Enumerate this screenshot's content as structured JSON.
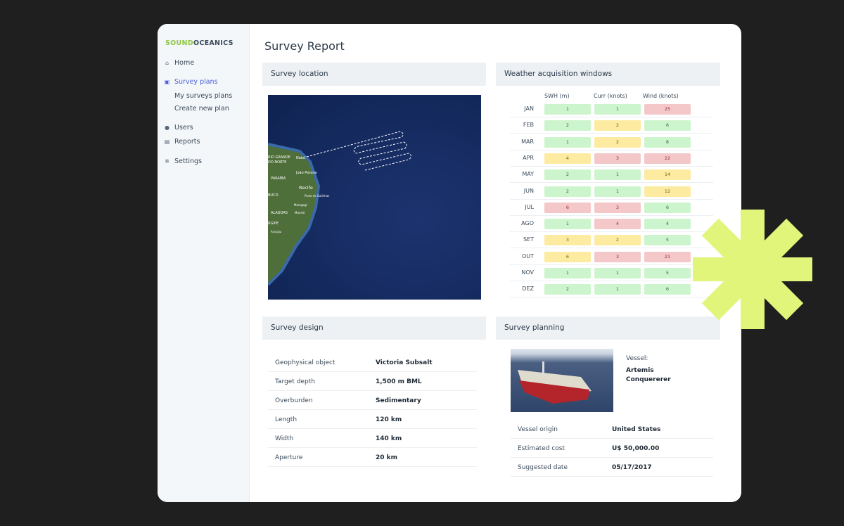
{
  "brand": {
    "part1": "SOUND",
    "part2": "OCEANICS"
  },
  "sidebar": {
    "items": [
      {
        "label": "Home",
        "icon": "home-icon"
      },
      {
        "label": "Survey plans",
        "icon": "survey-plans-icon",
        "active": true,
        "children": [
          "My surveys plans",
          "Create new plan"
        ]
      },
      {
        "label": "Users",
        "icon": "user-icon"
      },
      {
        "label": "Reports",
        "icon": "reports-icon"
      },
      {
        "label": "Settings",
        "icon": "gear-icon"
      }
    ]
  },
  "page_title": "Survey Report",
  "location": {
    "title": "Survey location",
    "map_labels": [
      "Natal",
      "RIO GRANDE",
      "DO NORTE",
      "João Pessoa",
      "PARAÍBA",
      "Recife",
      "BUCO",
      "Porto de Galinhas",
      "Maragogi",
      "ALAGOAS",
      "Maceió",
      "RGIPE",
      "Aracaju"
    ]
  },
  "weather": {
    "title": "Weather acquisition windows",
    "columns": [
      "SWH (m)",
      "Curr (knots)",
      "Wind (knots)"
    ],
    "status_colors": {
      "good": "#cdf5cd",
      "moderate": "#fcebA0",
      "bad": "#f4c7c9"
    },
    "rows": [
      {
        "month": "JAN",
        "values": [
          [
            "1",
            "good"
          ],
          [
            "1",
            "good"
          ],
          [
            "25",
            "bad"
          ]
        ]
      },
      {
        "month": "FEB",
        "values": [
          [
            "2",
            "good"
          ],
          [
            "2",
            "moderate"
          ],
          [
            "6",
            "good"
          ]
        ]
      },
      {
        "month": "MAR",
        "values": [
          [
            "1",
            "good"
          ],
          [
            "2",
            "moderate"
          ],
          [
            "8",
            "good"
          ]
        ]
      },
      {
        "month": "APR",
        "values": [
          [
            "4",
            "moderate"
          ],
          [
            "3",
            "bad"
          ],
          [
            "22",
            "bad"
          ]
        ]
      },
      {
        "month": "MAY",
        "values": [
          [
            "2",
            "good"
          ],
          [
            "1",
            "good"
          ],
          [
            "14",
            "moderate"
          ]
        ]
      },
      {
        "month": "JUN",
        "values": [
          [
            "2",
            "good"
          ],
          [
            "1",
            "good"
          ],
          [
            "12",
            "moderate"
          ]
        ]
      },
      {
        "month": "JUL",
        "values": [
          [
            "6",
            "bad"
          ],
          [
            "3",
            "bad"
          ],
          [
            "6",
            "good"
          ]
        ]
      },
      {
        "month": "AGO",
        "values": [
          [
            "1",
            "good"
          ],
          [
            "4",
            "bad"
          ],
          [
            "4",
            "good"
          ]
        ]
      },
      {
        "month": "SET",
        "values": [
          [
            "3",
            "moderate"
          ],
          [
            "2",
            "moderate"
          ],
          [
            "5",
            "good"
          ]
        ]
      },
      {
        "month": "OUT",
        "values": [
          [
            "6",
            "moderate"
          ],
          [
            "3",
            "bad"
          ],
          [
            "21",
            "bad"
          ]
        ]
      },
      {
        "month": "NOV",
        "values": [
          [
            "1",
            "good"
          ],
          [
            "1",
            "good"
          ],
          [
            "5",
            "good"
          ]
        ]
      },
      {
        "month": "DEZ",
        "values": [
          [
            "2",
            "good"
          ],
          [
            "1",
            "good"
          ],
          [
            "6",
            "good"
          ]
        ]
      }
    ]
  },
  "design": {
    "title": "Survey design",
    "rows": [
      {
        "label": "Geophysical object",
        "value": "Victoria Subsalt"
      },
      {
        "label": "Target depth",
        "value": "1,500 m BML"
      },
      {
        "label": "Overburden",
        "value": "Sedimentary"
      },
      {
        "label": "Length",
        "value": "120 km"
      },
      {
        "label": "Width",
        "value": "140 km"
      },
      {
        "label": "Aperture",
        "value": "20 km"
      }
    ]
  },
  "planning": {
    "title": "Survey planning",
    "vessel_label": "Vessel:",
    "vessel_name_1": "Artemis",
    "vessel_name_2": "Conquererer",
    "rows": [
      {
        "label": "Vessel origin",
        "value": "United States"
      },
      {
        "label": "Estimated cost",
        "value": "U$ 50,000.00"
      },
      {
        "label": "Suggested date",
        "value": "05/17/2017"
      }
    ]
  },
  "accent_color": "#e0f57a"
}
